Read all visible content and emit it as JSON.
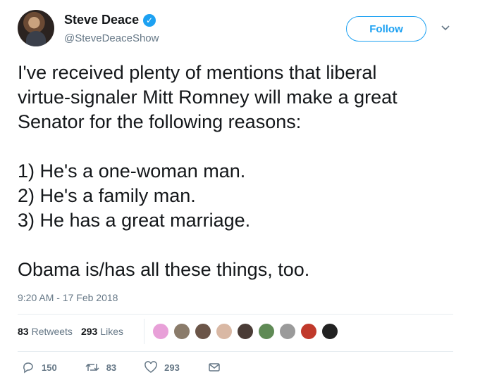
{
  "author": {
    "display_name": "Steve Deace",
    "handle": "@SteveDeaceShow",
    "verified_icon": "verified-badge-icon"
  },
  "follow_label": "Follow",
  "tweet": {
    "lines": [
      "I've received plenty of mentions that liberal",
      "virtue-signaler Mitt Romney will make a great",
      "Senator for the following reasons:",
      "1) He's a one-woman man.",
      "2) He's a family man.",
      "3) He has a great marriage.",
      "Obama is/has all these things, too."
    ]
  },
  "timestamp": "9:20 AM - 17 Feb 2018",
  "stats": {
    "retweets_count": "83",
    "retweets_label": "Retweets",
    "likes_count": "293",
    "likes_label": "Likes"
  },
  "liker_colors": [
    "#e8a0d8",
    "#8a7b6a",
    "#6b5548",
    "#d9b8a4",
    "#4a3c36",
    "#5f8a55",
    "#9a9a9a",
    "#c0392b",
    "#222222"
  ],
  "actions": {
    "replies": "150",
    "retweets": "83",
    "likes": "293"
  },
  "colors": {
    "accent": "#1da1f2",
    "secondary_text": "#657786"
  }
}
